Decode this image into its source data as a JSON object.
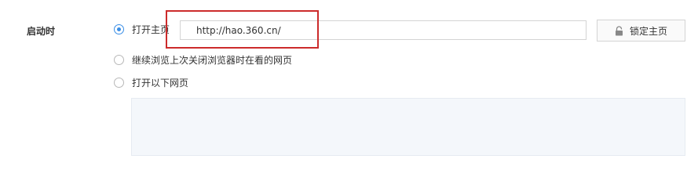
{
  "startup": {
    "label": "启动时",
    "options": [
      {
        "label": "打开主页",
        "checked": true
      },
      {
        "label": "继续浏览上次关闭浏览器时在看的网页",
        "checked": false
      },
      {
        "label": "打开以下网页",
        "checked": false
      }
    ],
    "homepage_url": "http://hao.360.cn/",
    "lock_button": {
      "label": "锁定主页",
      "icon": "lock-icon"
    }
  },
  "colors": {
    "accent": "#3a8ee6",
    "annotation_red": "#cc2b2b",
    "pages_box_bg": "#f4f7fb"
  }
}
